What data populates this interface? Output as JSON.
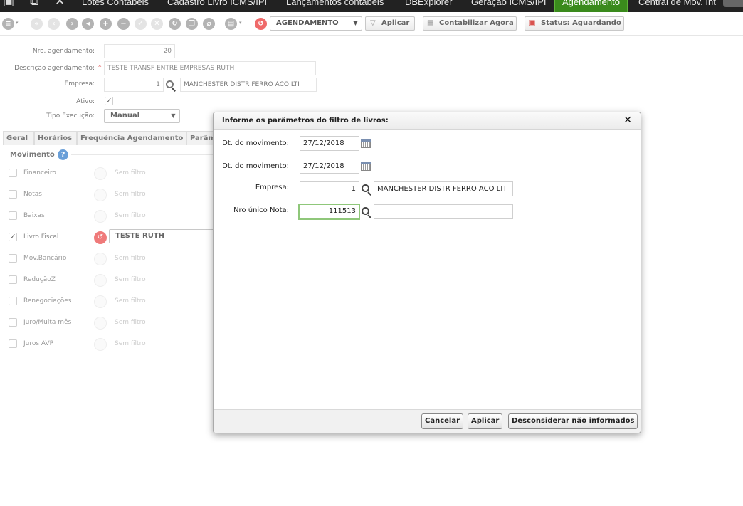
{
  "topbar": {
    "tabs": [
      {
        "label": "Lotes Contábeis"
      },
      {
        "label": "Cadastro Livro ICMS/IPI"
      },
      {
        "label": "Lançamentos contábeis"
      },
      {
        "label": "DBExplorer"
      },
      {
        "label": "Geração ICMS/IPI"
      },
      {
        "label": "Agendamento"
      },
      {
        "label": "Central de Mov. Int"
      }
    ]
  },
  "toolbar": {
    "view_select": "AGENDAMENTO",
    "apply_label": "Aplicar",
    "post_now_label": "Contabilizar Agora",
    "status_label": "Status: Aguardando"
  },
  "form": {
    "nro_label": "Nro. agendamento:",
    "nro_value": "20",
    "desc_label": "Descrição agendamento:",
    "desc_required": "*",
    "desc_value": "TESTE TRANSF ENTRE EMPRESAS RUTH",
    "empresa_label": "Empresa:",
    "empresa_code": "1",
    "empresa_name": "MANCHESTER DISTR FERRO ACO LTI",
    "ativo_label": "Ativo:",
    "ativo_check": "✓",
    "tipo_label": "Tipo Execução:",
    "tipo_value": "Manual"
  },
  "subtabs": [
    {
      "label": "Geral"
    },
    {
      "label": "Horários"
    },
    {
      "label": "Frequência Agendamento"
    },
    {
      "label": "Parâm"
    }
  ],
  "movimento": {
    "title": "Movimento",
    "help": "?",
    "rows": [
      {
        "label": "Financeiro",
        "filter": "Sem filtro",
        "checked": false
      },
      {
        "label": "Notas",
        "filter": "Sem filtro",
        "checked": false
      },
      {
        "label": "Baixas",
        "filter": "Sem filtro",
        "checked": false
      },
      {
        "label": "Livro Fiscal",
        "filter": "TESTE RUTH",
        "checked": true
      },
      {
        "label": "Mov.Bancário",
        "filter": "Sem filtro",
        "checked": false
      },
      {
        "label": "ReduçãoZ",
        "filter": "Sem filtro",
        "checked": false
      },
      {
        "label": "Renegociações",
        "filter": "Sem filtro",
        "checked": false
      },
      {
        "label": "Juro/Multa mês",
        "filter": "Sem filtro",
        "checked": false
      },
      {
        "label": "Juros AVP",
        "filter": "Sem filtro",
        "checked": false
      }
    ],
    "check_mark": "✓"
  },
  "modal": {
    "title": "Informe os parâmetros do filtro de livros:",
    "close": "✕",
    "dt1_label": "Dt. do movimento:",
    "dt1_value": "27/12/2018",
    "dt2_label": "Dt. do movimento:",
    "dt2_value": "27/12/2018",
    "empresa_label": "Empresa:",
    "empresa_code": "1",
    "empresa_name": "MANCHESTER DISTR FERRO ACO LTI",
    "nota_label": "Nro único Nota:",
    "nota_value": "111513",
    "nota_desc": "",
    "cancel_label": "Cancelar",
    "apply_label": "Aplicar",
    "ignore_label": "Desconsiderar não informados"
  }
}
